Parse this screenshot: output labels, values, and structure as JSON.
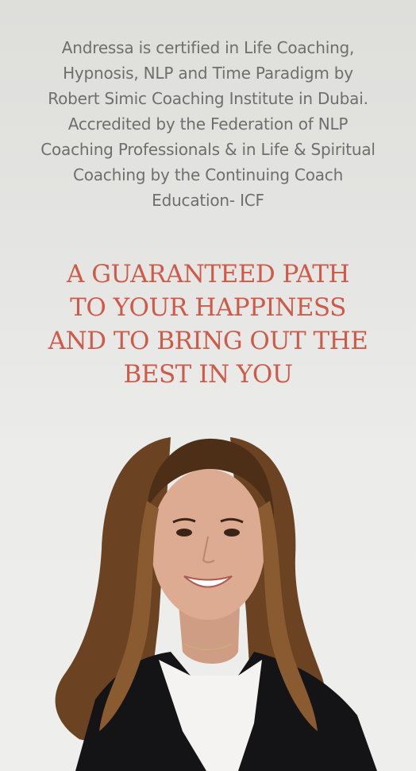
{
  "bio": {
    "lines": [
      "Andressa is certified in Life Coaching,",
      "Hypnosis, NLP and Time Paradigm by",
      "Robert Simic Coaching Institute in Dubai.",
      "Accredited by the Federation of NLP",
      "Coaching Professionals & in Life & Spiritual",
      "Coaching by the Continuing Coach",
      "Education- ICF"
    ]
  },
  "headline": {
    "lines": [
      "A GUARANTEED PATH",
      "TO YOUR HAPPINESS",
      "AND TO BRING OUT THE",
      "BEST IN YOU"
    ]
  },
  "colors": {
    "background": "#e6e6e4",
    "body_text": "#6e6e6e",
    "accent": "#cf5a48"
  },
  "portrait": {
    "icon": "woman-portrait"
  }
}
